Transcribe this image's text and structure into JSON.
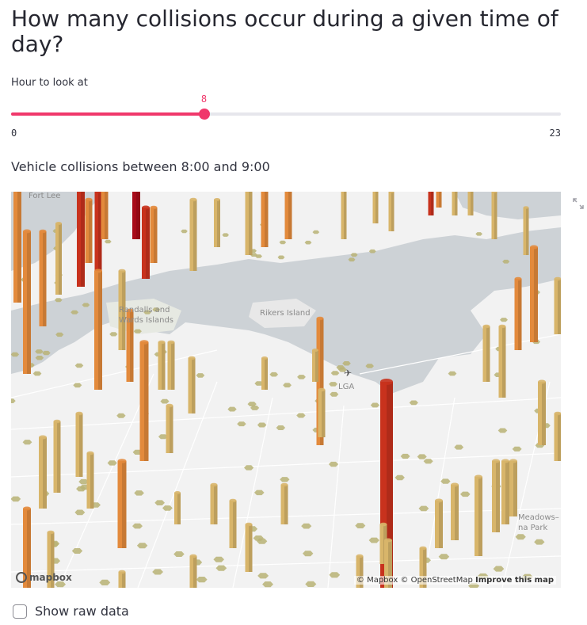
{
  "title": "How many collisions occur during a given time of day?",
  "slider": {
    "label": "Hour to look at",
    "value": 8,
    "min": 0,
    "max": 23,
    "min_label": "0",
    "max_label": "23",
    "value_label": "8",
    "accent": "#f0386b"
  },
  "subheader": "Vehicle collisions between 8:00 and 9:00",
  "map": {
    "labels": {
      "fort_lee": "Fort Lee",
      "randalls_1": "Randalls and",
      "randalls_2": "Wards Islands",
      "rikers": "Rikers Island",
      "lga": "LGA",
      "meadows_1": "Meadows–",
      "meadows_2": "na Park"
    },
    "attribution": {
      "mapbox": "© Mapbox",
      "osm": "© OpenStreetMap",
      "improve": "Improve this map"
    },
    "logo": "mapbox",
    "colors": {
      "land": "#f2f2f2",
      "water": "#cdd2d6",
      "park": "#e6e9e2",
      "hex": "#b8b376",
      "low": "#d8b56a",
      "mid": "#e38a3c",
      "high": "#c8321d",
      "max": "#a80b1a"
    }
  },
  "show_raw_label": "Show raw data",
  "icons": {
    "fullscreen": "fullscreen-icon",
    "airport": "airport-icon"
  }
}
